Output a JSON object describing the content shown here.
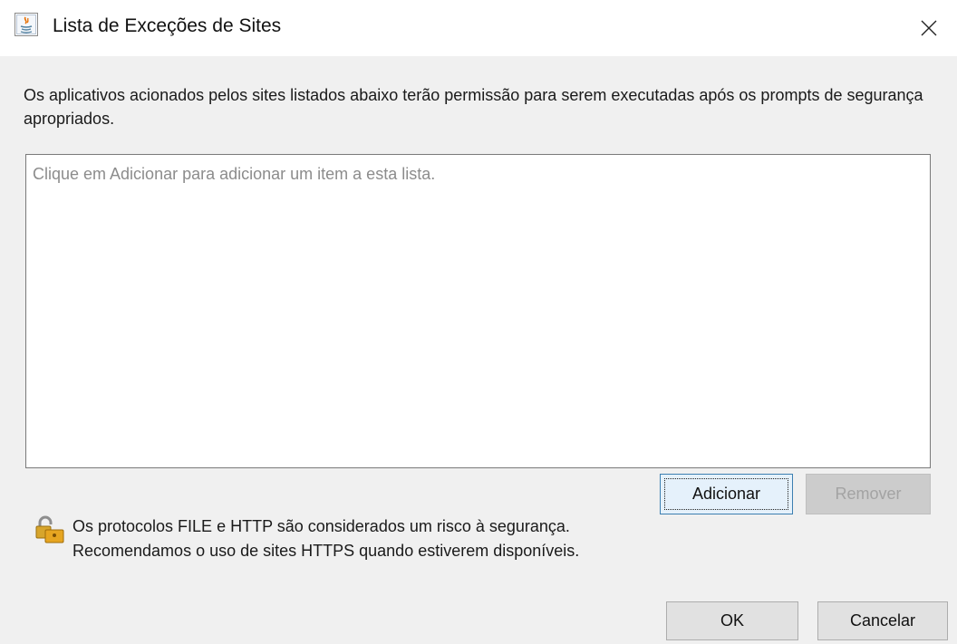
{
  "window": {
    "title": "Lista de Exceções de Sites",
    "app_icon": "java-icon",
    "close_icon": "close-icon"
  },
  "description": "Os aplicativos acionados pelos sites listados abaixo terão permissão para serem executadas após os prompts de segurança apropriados.",
  "exception_list": {
    "placeholder": "Clique em Adicionar para adicionar um item a esta lista.",
    "items": []
  },
  "list_buttons": {
    "add_label": "Adicionar",
    "remove_label": "Remover",
    "remove_enabled": false
  },
  "security_note": {
    "icon": "unlocked-padlock-icon",
    "line1": "Os protocolos FILE e HTTP são considerados um risco à segurança.",
    "line2": "Recomendamos o uso de sites HTTPS quando estiverem disponíveis."
  },
  "dialog_buttons": {
    "ok_label": "OK",
    "cancel_label": "Cancelar"
  },
  "colors": {
    "window_bg": "#f0f0f0",
    "titlebar_bg": "#ffffff",
    "focus_border": "#3c7fb1",
    "disabled_text": "#a3a3a3"
  }
}
